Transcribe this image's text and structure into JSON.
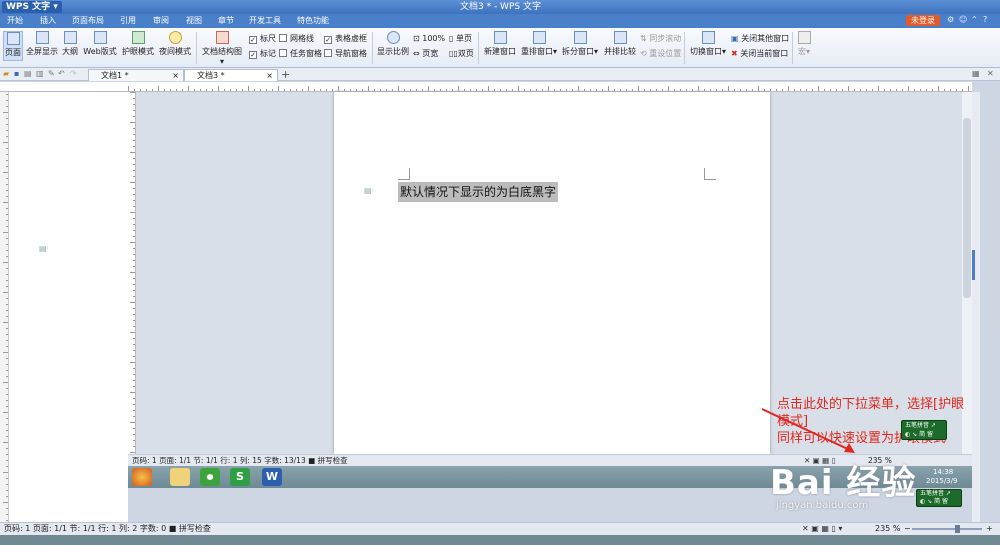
{
  "app": {
    "badge": "WPS 文字",
    "doc_title": "文档3 * - WPS 文字",
    "login_label": "未登录",
    "title_icons": [
      "skin-icon",
      "settings-icon",
      "minimize-icon",
      "help-icon"
    ]
  },
  "menu": [
    "开始",
    "插入",
    "页面布局",
    "引用",
    "审阅",
    "视图",
    "章节",
    "开发工具",
    "特色功能"
  ],
  "ribbon": {
    "view_buttons": [
      "页面",
      "全屏显示",
      "大纲",
      "Web版式",
      "护眼模式",
      "夜间模式"
    ],
    "doc_map": "文档结构图",
    "checks": [
      {
        "label": "标尺",
        "checked": true
      },
      {
        "label": "网格线",
        "checked": false
      },
      {
        "label": "表格虚框",
        "checked": true
      },
      {
        "label": "标记",
        "checked": true
      },
      {
        "label": "任务窗格",
        "checked": false
      },
      {
        "label": "导航窗格",
        "checked": false
      }
    ],
    "zoom_label": "显示比例",
    "zoom_100": "100%",
    "single_page": "单页",
    "page_width": "页宽",
    "double_page": "双页",
    "window_buttons": [
      "新建窗口",
      "重排窗口",
      "拆分窗口",
      "并排比较"
    ],
    "sync_scroll": "同步滚动",
    "reset_pos": "重设位置",
    "switch_window": "切换窗口",
    "close_others": "关闭其他窗口",
    "close_current": "关闭当前窗口",
    "macro": "宏"
  },
  "tabs": [
    "文档1 *",
    "文档3 *"
  ],
  "document": {
    "body_text": "默认情况下显示的为白底黑字"
  },
  "inner_status": "页码: 1  页面: 1/1  节: 1/1  行: 1  列: 15  字数: 13/13  ■ 拼写检查",
  "inner_zoom": "235 %",
  "outer_status": "页码: 1  页面: 1/1  节: 1/1  行: 1  列: 2  字数: 0  ■ 拼写检查",
  "outer_zoom": "235 %",
  "annotation": {
    "line1": "点击此处的下拉菜单，选择[护眼",
    "line2": "模式]",
    "line3": "同样可以快速设置为护眼模式"
  },
  "ime": {
    "line1": "五笔拼音 ↗",
    "line2": "◐ ↘ 简 留"
  },
  "taskbar_clock": {
    "time": "14:38",
    "date": "2015/3/9"
  },
  "watermark": {
    "main": "Bai 经验",
    "sub": "jingyan.baidu.com"
  },
  "colors": {
    "accent": "#4a7fc9",
    "annotation": "#e0281e",
    "ime": "#1c6b2a"
  }
}
